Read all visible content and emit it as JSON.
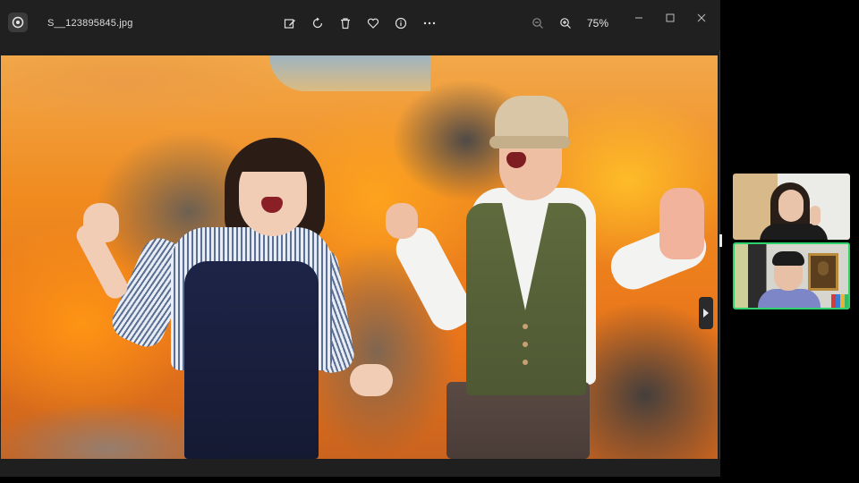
{
  "viewer": {
    "filename": "S__123895845.jpg",
    "zoom_level": "75%",
    "toolbar": {
      "icons": [
        "edit-image-icon",
        "rotate-icon",
        "delete-icon",
        "favorite-icon",
        "info-icon",
        "more-icon"
      ],
      "zoom_icons": [
        "zoom-out-icon",
        "zoom-in-icon"
      ]
    },
    "window_controls": [
      "minimize-icon",
      "maximize-icon",
      "close-icon"
    ]
  },
  "photo": {
    "description_colors": {
      "fire": "#f08b1f",
      "smoke": "#5a5a5c"
    }
  },
  "video_call": {
    "tiles": [
      "participant-1",
      "participant-2"
    ],
    "active_speaker_color": "#2fd16a"
  }
}
